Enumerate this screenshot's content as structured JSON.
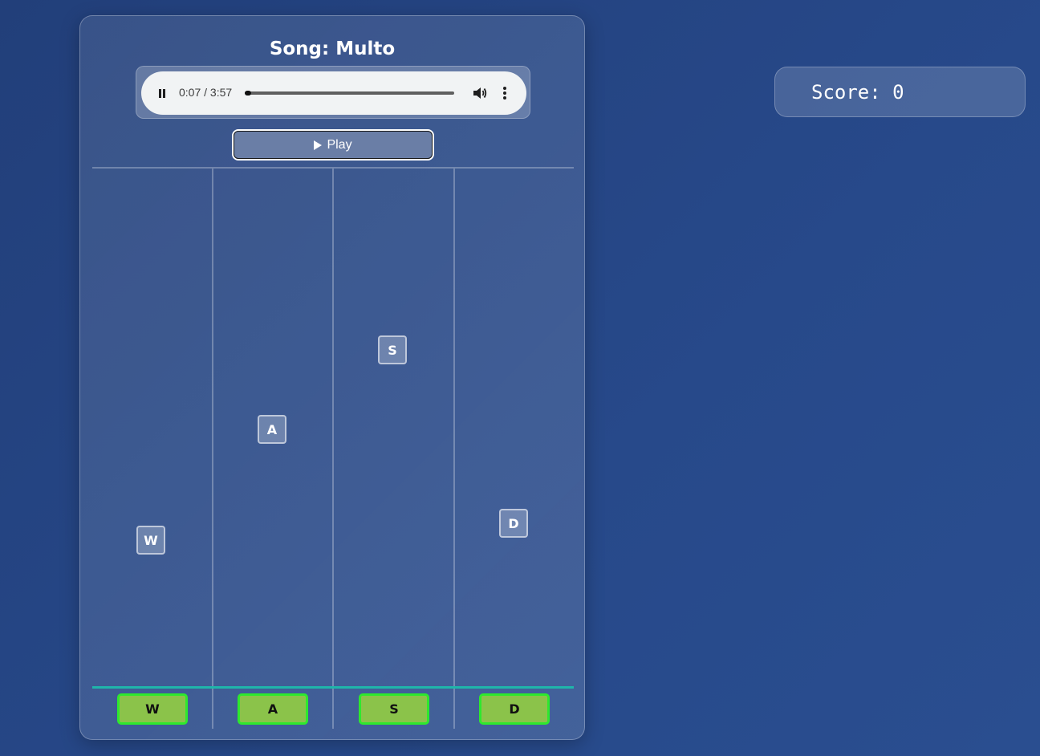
{
  "song": {
    "label": "Song: Multo"
  },
  "audio": {
    "time": "0:07 / 3:57",
    "progress_fraction": 0.03,
    "pause_icon": "pause-icon",
    "volume_icon": "volume-icon",
    "menu_icon": "more-vert-icon"
  },
  "play_button": {
    "label": "Play",
    "icon": "play-icon"
  },
  "notes": [
    {
      "lane": "W",
      "label": "W"
    },
    {
      "lane": "A",
      "label": "A"
    },
    {
      "lane": "S",
      "label": "S"
    },
    {
      "lane": "D",
      "label": "D"
    }
  ],
  "keys": [
    "W",
    "A",
    "S",
    "D"
  ],
  "score": {
    "label": "Score: 0"
  },
  "colors": {
    "background": "#24447f",
    "hit_line": "#1fb5aa",
    "key_fill": "#8bc34a",
    "key_border": "#2ee82e"
  }
}
